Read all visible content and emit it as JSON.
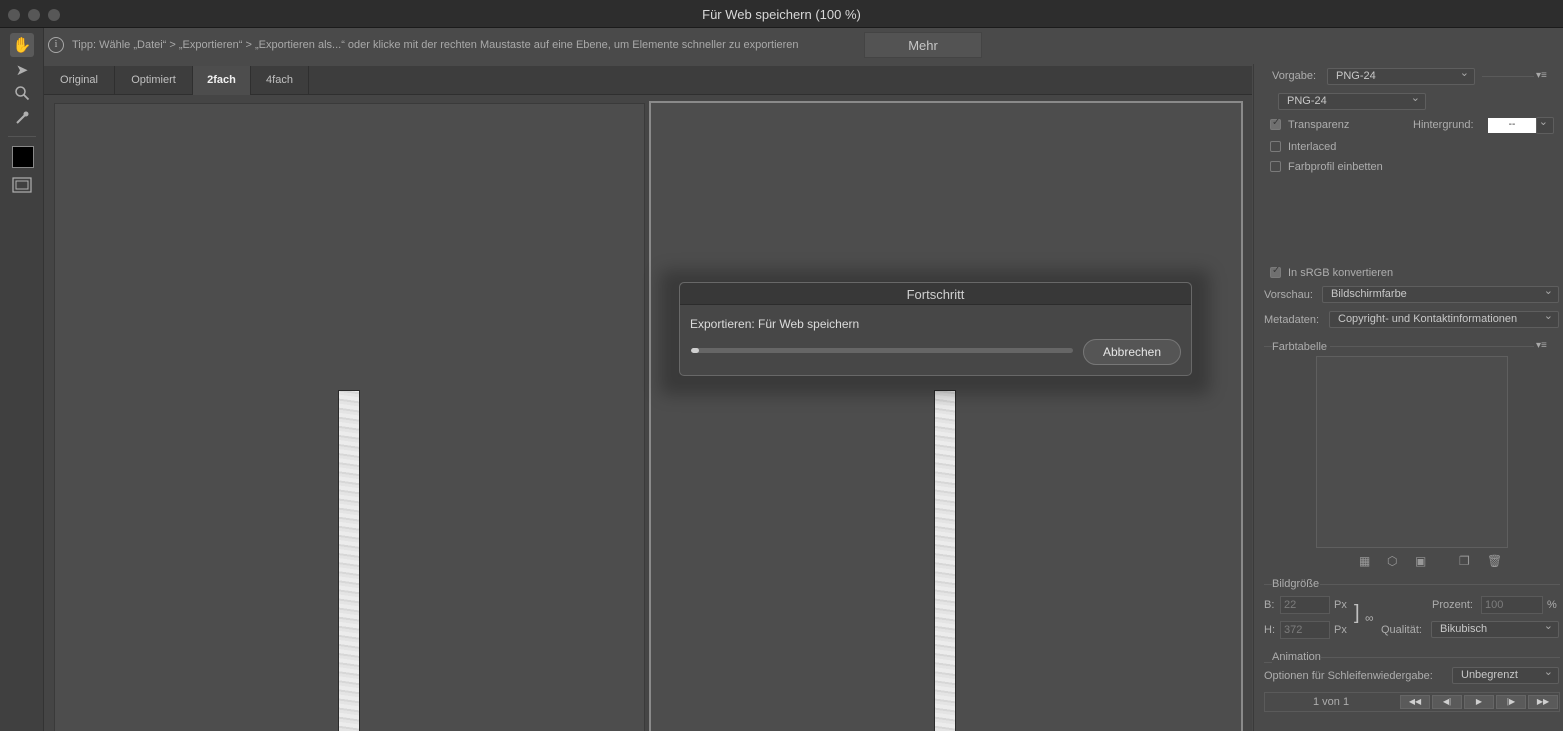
{
  "window": {
    "title": "Für Web speichern (100 %)"
  },
  "hint": {
    "text": "Tipp: Wähle „Datei“ > „Exportieren“ > „Exportieren als...“ oder klicke mit der rechten Maustaste auf eine Ebene, um Elemente schneller zu exportieren",
    "more_label": "Mehr"
  },
  "tools": [
    "hand-icon",
    "slice-select-icon",
    "zoom-icon",
    "eyedropper-icon",
    "color-swatch",
    "preview-toggle-icon"
  ],
  "tabs": [
    {
      "label": "Original"
    },
    {
      "label": "Optimiert"
    },
    {
      "label": "2fach",
      "active": true
    },
    {
      "label": "4fach"
    }
  ],
  "settings": {
    "preset_label": "Vorgabe:",
    "preset_value": "PNG-24",
    "format_value": "PNG-24",
    "transparency_label": "Transparenz",
    "transparency_checked": true,
    "background_label": "Hintergrund:",
    "background_value": "--",
    "interlaced_label": "Interlaced",
    "interlaced_checked": false,
    "embed_profile_label": "Farbprofil einbetten",
    "embed_profile_checked": false,
    "srgb_label": "In sRGB konvertieren",
    "srgb_checked": true,
    "preview_label": "Vorschau:",
    "preview_value": "Bildschirmfarbe",
    "metadata_label": "Metadaten:",
    "metadata_value": "Copyright- und Kontaktinformationen",
    "color_table_label": "Farbtabelle"
  },
  "image_size": {
    "section_label": "Bildgröße",
    "width_label": "B:",
    "width_value": "22",
    "height_label": "H:",
    "height_value": "372",
    "unit": "Px",
    "percent_label": "Prozent:",
    "percent_value": "100",
    "percent_unit": "%",
    "quality_label": "Qualität:",
    "quality_value": "Bikubisch"
  },
  "animation": {
    "section_label": "Animation",
    "loop_label": "Optionen für Schleifenwiedergabe:",
    "loop_value": "Unbegrenzt",
    "frame_counter": "1 von 1"
  },
  "progress_dialog": {
    "title": "Fortschritt",
    "message": "Exportieren: Für Web speichern",
    "progress_percent": 2,
    "cancel_label": "Abbrechen"
  }
}
